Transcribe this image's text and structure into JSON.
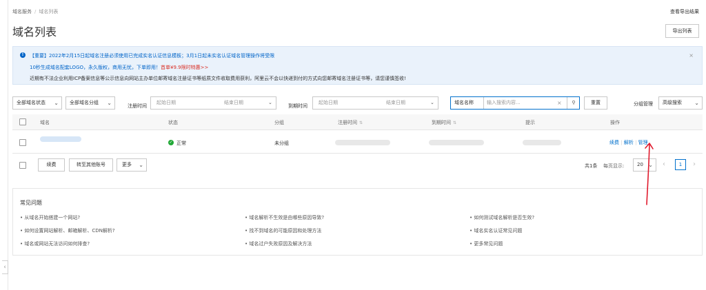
{
  "breadcrumb": {
    "root": "域名服务",
    "current": "域名列表"
  },
  "top_link": "查看导出结果",
  "page_title": "域名列表",
  "export_button": "导出列表",
  "notice": {
    "line1": "【重要】2022年2月15日起域名注册必须使用已完成实名认证信息模板；3月1日起未实名认证域名管理操作将受限",
    "line2_prefix": "10秒生成域名配套LOGO，永久版权，商用无忧，下单即用！",
    "line2_highlight": "首单¥9.9限时特惠>>",
    "line3": "近期有不法企业利用ICP备案信息等公示信息向网站主办单位邮寄域名注册证书等纸质文件收取费用获利，阿里云不会以快递到付的方式向您邮寄域名注册证书等，请您谨慎签收!",
    "close": "×"
  },
  "filters": {
    "status_select": "全部域名状态",
    "group_select": "全部域名分组",
    "reg_time_label": "注册时间",
    "reg_start": "起始日期",
    "reg_end": "结束日期",
    "exp_time_label": "到期时间",
    "exp_start": "起始日期",
    "exp_end": "结束日期",
    "search_type": "域名名称",
    "search_placeholder": "输入搜索内容...",
    "reset_button": "重置",
    "group_manage": "分组管理",
    "advanced_search": "高级搜索"
  },
  "table": {
    "headers": [
      "域名",
      "状态",
      "分组",
      "注册时间",
      "到期时间",
      "提示",
      "操作"
    ],
    "sort_icon": "⇅",
    "rows": [
      {
        "status": "正常",
        "group": "未分组",
        "actions": [
          "续费",
          "解析",
          "管理"
        ]
      }
    ]
  },
  "bulk_actions": {
    "renew": "续费",
    "transfer": "转至其他账号",
    "more": "更多"
  },
  "pagination": {
    "total": "共1条",
    "per_page_label": "每页显示:",
    "per_page_value": "20",
    "current_page": "1",
    "prev": "‹",
    "next": "›"
  },
  "faq": {
    "title": "常见问题",
    "items": [
      "从域名开始搭建一个网站?",
      "域名解析不生效是由哪些原因导致?",
      "如何测试域名解析是否生效?",
      "如何设置网站解析、邮箱解析、CDN解析?",
      "找不到域名的可能原因和处理方法",
      "域名实名认证常见问题",
      "域名或网站无法访问如何排查?",
      "域名过户失败原因及解决方法",
      "更多常见问题"
    ]
  },
  "colors": {
    "accent": "#0070cc",
    "success": "#21a836",
    "annotation": "#e0182b",
    "notice_bg": "#eaf2fb"
  }
}
